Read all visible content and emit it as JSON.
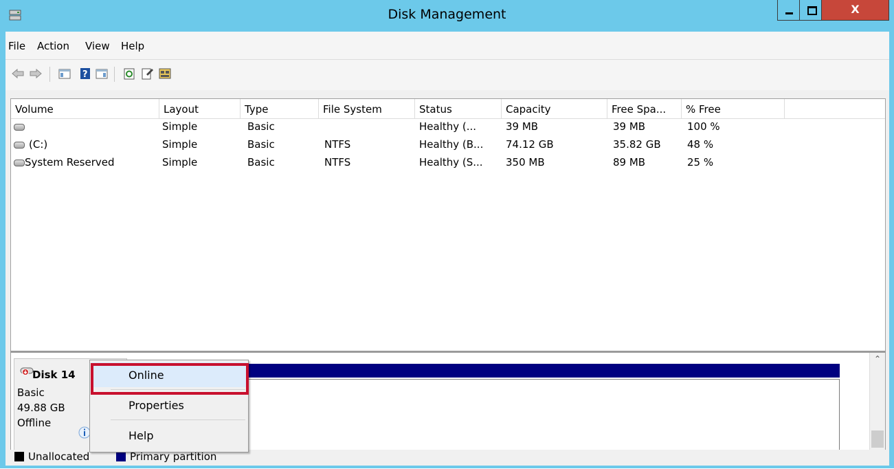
{
  "window": {
    "title": "Disk Management",
    "close_glyph": "X"
  },
  "menubar": {
    "items": [
      "File",
      "Action",
      "View",
      "Help"
    ]
  },
  "toolbar": {
    "icons": [
      "back-arrow-icon",
      "forward-arrow-icon",
      "show-hide-console-tree-icon",
      "help-icon",
      "show-hide-action-pane-icon",
      "refresh-icon",
      "properties-icon",
      "export-list-icon"
    ]
  },
  "volume_list": {
    "columns": [
      "Volume",
      "Layout",
      "Type",
      "File System",
      "Status",
      "Capacity",
      "Free Spa...",
      "% Free"
    ],
    "rows": [
      {
        "volume": "",
        "layout": "Simple",
        "type": "Basic",
        "filesystem": "",
        "status": "Healthy (...",
        "capacity": "39 MB",
        "free": "39 MB",
        "pct_free": "100 %"
      },
      {
        "volume": "(C:)",
        "layout": "Simple",
        "type": "Basic",
        "filesystem": "NTFS",
        "status": "Healthy (B...",
        "capacity": "74.12 GB",
        "free": "35.82 GB",
        "pct_free": "48 %"
      },
      {
        "volume": "System Reserved",
        "layout": "Simple",
        "type": "Basic",
        "filesystem": "NTFS",
        "status": "Healthy (S...",
        "capacity": "350 MB",
        "free": "89 MB",
        "pct_free": "25 %"
      }
    ]
  },
  "disk": {
    "name": "Disk 14",
    "type": "Basic",
    "size": "49.88 GB",
    "state": "Offline"
  },
  "context_menu": {
    "online": "Online",
    "properties": "Properties",
    "help": "Help"
  },
  "legend": {
    "unallocated": "Unallocated",
    "primary": "Primary partition",
    "unallocated_color": "#000000",
    "primary_color": "#000080"
  },
  "colors": {
    "titlebar": "#6cc9ea",
    "close_button": "#c7473a",
    "highlight_border": "#c8102e",
    "menu_highlight": "#dcebfb"
  }
}
